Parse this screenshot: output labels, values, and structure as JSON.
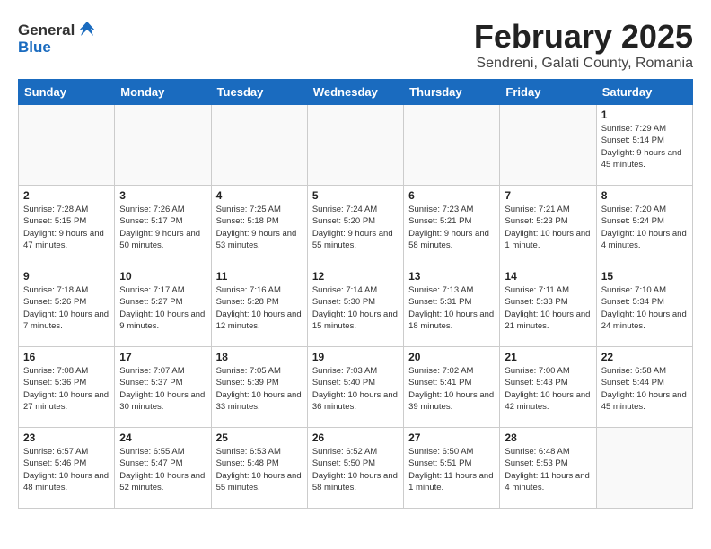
{
  "header": {
    "logo_general": "General",
    "logo_blue": "Blue",
    "title": "February 2025",
    "subtitle": "Sendreni, Galati County, Romania"
  },
  "weekdays": [
    "Sunday",
    "Monday",
    "Tuesday",
    "Wednesday",
    "Thursday",
    "Friday",
    "Saturday"
  ],
  "weeks": [
    [
      {
        "day": "",
        "info": ""
      },
      {
        "day": "",
        "info": ""
      },
      {
        "day": "",
        "info": ""
      },
      {
        "day": "",
        "info": ""
      },
      {
        "day": "",
        "info": ""
      },
      {
        "day": "",
        "info": ""
      },
      {
        "day": "1",
        "info": "Sunrise: 7:29 AM\nSunset: 5:14 PM\nDaylight: 9 hours and 45 minutes."
      }
    ],
    [
      {
        "day": "2",
        "info": "Sunrise: 7:28 AM\nSunset: 5:15 PM\nDaylight: 9 hours and 47 minutes."
      },
      {
        "day": "3",
        "info": "Sunrise: 7:26 AM\nSunset: 5:17 PM\nDaylight: 9 hours and 50 minutes."
      },
      {
        "day": "4",
        "info": "Sunrise: 7:25 AM\nSunset: 5:18 PM\nDaylight: 9 hours and 53 minutes."
      },
      {
        "day": "5",
        "info": "Sunrise: 7:24 AM\nSunset: 5:20 PM\nDaylight: 9 hours and 55 minutes."
      },
      {
        "day": "6",
        "info": "Sunrise: 7:23 AM\nSunset: 5:21 PM\nDaylight: 9 hours and 58 minutes."
      },
      {
        "day": "7",
        "info": "Sunrise: 7:21 AM\nSunset: 5:23 PM\nDaylight: 10 hours and 1 minute."
      },
      {
        "day": "8",
        "info": "Sunrise: 7:20 AM\nSunset: 5:24 PM\nDaylight: 10 hours and 4 minutes."
      }
    ],
    [
      {
        "day": "9",
        "info": "Sunrise: 7:18 AM\nSunset: 5:26 PM\nDaylight: 10 hours and 7 minutes."
      },
      {
        "day": "10",
        "info": "Sunrise: 7:17 AM\nSunset: 5:27 PM\nDaylight: 10 hours and 9 minutes."
      },
      {
        "day": "11",
        "info": "Sunrise: 7:16 AM\nSunset: 5:28 PM\nDaylight: 10 hours and 12 minutes."
      },
      {
        "day": "12",
        "info": "Sunrise: 7:14 AM\nSunset: 5:30 PM\nDaylight: 10 hours and 15 minutes."
      },
      {
        "day": "13",
        "info": "Sunrise: 7:13 AM\nSunset: 5:31 PM\nDaylight: 10 hours and 18 minutes."
      },
      {
        "day": "14",
        "info": "Sunrise: 7:11 AM\nSunset: 5:33 PM\nDaylight: 10 hours and 21 minutes."
      },
      {
        "day": "15",
        "info": "Sunrise: 7:10 AM\nSunset: 5:34 PM\nDaylight: 10 hours and 24 minutes."
      }
    ],
    [
      {
        "day": "16",
        "info": "Sunrise: 7:08 AM\nSunset: 5:36 PM\nDaylight: 10 hours and 27 minutes."
      },
      {
        "day": "17",
        "info": "Sunrise: 7:07 AM\nSunset: 5:37 PM\nDaylight: 10 hours and 30 minutes."
      },
      {
        "day": "18",
        "info": "Sunrise: 7:05 AM\nSunset: 5:39 PM\nDaylight: 10 hours and 33 minutes."
      },
      {
        "day": "19",
        "info": "Sunrise: 7:03 AM\nSunset: 5:40 PM\nDaylight: 10 hours and 36 minutes."
      },
      {
        "day": "20",
        "info": "Sunrise: 7:02 AM\nSunset: 5:41 PM\nDaylight: 10 hours and 39 minutes."
      },
      {
        "day": "21",
        "info": "Sunrise: 7:00 AM\nSunset: 5:43 PM\nDaylight: 10 hours and 42 minutes."
      },
      {
        "day": "22",
        "info": "Sunrise: 6:58 AM\nSunset: 5:44 PM\nDaylight: 10 hours and 45 minutes."
      }
    ],
    [
      {
        "day": "23",
        "info": "Sunrise: 6:57 AM\nSunset: 5:46 PM\nDaylight: 10 hours and 48 minutes."
      },
      {
        "day": "24",
        "info": "Sunrise: 6:55 AM\nSunset: 5:47 PM\nDaylight: 10 hours and 52 minutes."
      },
      {
        "day": "25",
        "info": "Sunrise: 6:53 AM\nSunset: 5:48 PM\nDaylight: 10 hours and 55 minutes."
      },
      {
        "day": "26",
        "info": "Sunrise: 6:52 AM\nSunset: 5:50 PM\nDaylight: 10 hours and 58 minutes."
      },
      {
        "day": "27",
        "info": "Sunrise: 6:50 AM\nSunset: 5:51 PM\nDaylight: 11 hours and 1 minute."
      },
      {
        "day": "28",
        "info": "Sunrise: 6:48 AM\nSunset: 5:53 PM\nDaylight: 11 hours and 4 minutes."
      },
      {
        "day": "",
        "info": ""
      }
    ]
  ]
}
